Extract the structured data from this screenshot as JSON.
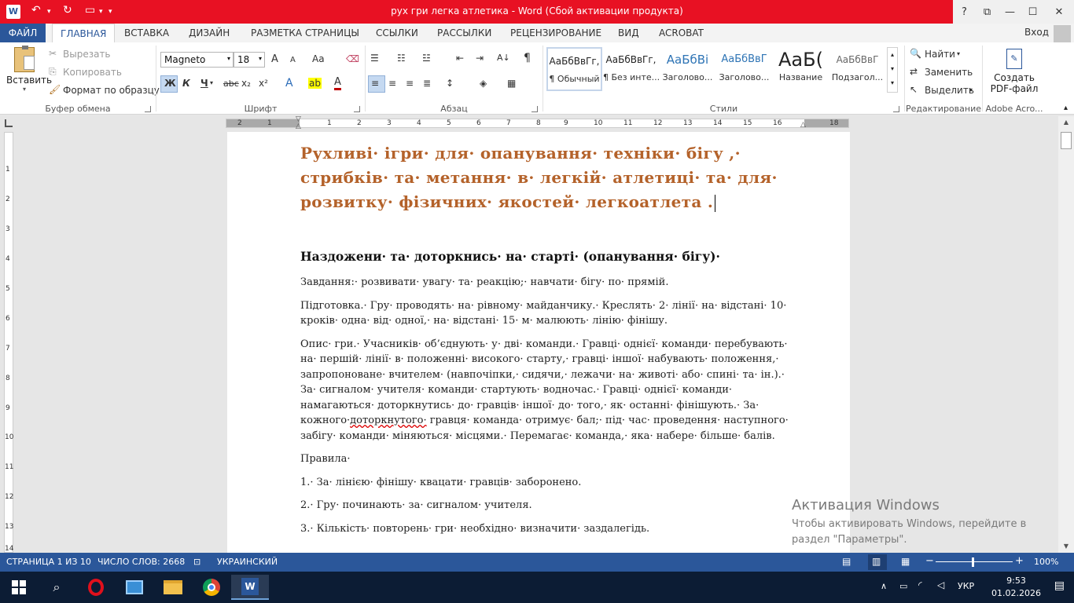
{
  "window": {
    "title": "рух гри легка атлетика -  Word (Сбой активации продукта)",
    "app_icon": "W",
    "help": "?",
    "ribbon_options": "⧉",
    "minimize": "—",
    "maximize": "☐",
    "close": "✕"
  },
  "tabs": [
    {
      "label": "ФАЙЛ"
    },
    {
      "label": "ГЛАВНАЯ"
    },
    {
      "label": "ВСТАВКА"
    },
    {
      "label": "ДИЗАЙН"
    },
    {
      "label": "РАЗМЕТКА СТРАНИЦЫ"
    },
    {
      "label": "ССЫЛКИ"
    },
    {
      "label": "РАССЫЛКИ"
    },
    {
      "label": "РЕЦЕНЗИРОВАНИЕ"
    },
    {
      "label": "ВИД"
    },
    {
      "label": "ACROBAT"
    }
  ],
  "login": "Вход",
  "clipboard": {
    "paste": "Вставить",
    "cut": "Вырезать",
    "copy": "Копировать",
    "format_painter": "Формат по образцу",
    "label": "Буфер обмена"
  },
  "font": {
    "name": "Magneto",
    "size": "18",
    "grow": "A",
    "shrink": "A",
    "case": "Aa",
    "bold": "Ж",
    "italic": "К",
    "underline": "Ч",
    "strike": "abc",
    "subscript": "x₂",
    "superscript": "x²",
    "effects": "A",
    "highlight": "ab",
    "color": "A",
    "label": "Шрифт"
  },
  "paragraph": {
    "label": "Абзац",
    "pilcrow": "¶",
    "sort": "A↓"
  },
  "styles": {
    "items": [
      {
        "preview": "АаБбВвГг,",
        "name": "¶ Обычный"
      },
      {
        "preview": "АаБбВвГг,",
        "name": "¶ Без инте..."
      },
      {
        "preview": "АаБбВі",
        "name": "Заголово..."
      },
      {
        "preview": "АаБбВвГ",
        "name": "Заголово..."
      },
      {
        "preview": "АаБ(",
        "name": "Название"
      },
      {
        "preview": "АаБбВвГ",
        "name": "Подзагол..."
      }
    ],
    "label": "Стили"
  },
  "editing": {
    "find": "Найти",
    "replace": "Заменить",
    "select": "Выделить",
    "label": "Редактирование"
  },
  "acrobat": {
    "create_pdf_line1": "Создать",
    "create_pdf_line2": "PDF-файл",
    "label": "Adobe Acro..."
  },
  "ruler": {
    "h_numbers": [
      "2",
      "1",
      "1",
      "2",
      "3",
      "4",
      "5",
      "6",
      "7",
      "8",
      "9",
      "10",
      "11",
      "12",
      "13",
      "14",
      "15",
      "16",
      "18"
    ],
    "v_numbers": [
      "1",
      "2",
      "3",
      "4",
      "5",
      "6",
      "7",
      "8",
      "9",
      "10",
      "11",
      "12",
      "13",
      "14"
    ]
  },
  "document": {
    "title": "Рухливі· ігри· для· опанування· техніки· бігу ,· стрибків· та· метання· в· легкій· атлетиці· та· для· розвитку· фізичних· якостей· легкоатлета .",
    "heading": "Наздожени· та· доторкнись· на· старті· (опанування· бігу)·",
    "p_task": "Завдання:· розвивати· увагу· та· реакцію;· навчати· бігу· по· прямій.",
    "p_prep": "Підготовка.· Гру· проводять· на· рівному· майданчику.· Креслять· 2· лінії· на· відстані· 10· кроків· одна· від· одної,· на· відстані· 15· м· малюють· лінію· фінішу.",
    "p_desc_a": "Опис· гри.· Учасників· об’єднують· у· дві· команди.· Гравці· однієї· команди· перебувають· на· першій· лінії· в· положенні· високого· старту,· гравці· іншої· набувають· положення,· запропоноване· вчителем· (навпочіпки,· сидячи,· лежачи· на· животі· або· спині· та· ін.).· За· сигналом· учителя· команди· стартують· водночас.· Гравці· однієї· команди· намагаються· доторкнутись· до· гравців· іншої· до· того,· як· останні· фінішують.· За· кожного·",
    "p_desc_wavy": "доторкнутого·",
    "p_desc_b": "гравця· команда· отримує· бал;· під· час· проведення· наступного· забігу· команди· міняються· місцями.· Перемагає· команда,· яка· набере· більше· балів.",
    "p_rules": "Правила·",
    "rule1": "1.· За· лінією· фінішу· квацати· гравців· заборонено.",
    "rule2": "2.· Гру· починають· за· сигналом· учителя.",
    "rule3": "3.· Кількість· повторень· гри· необхідно· визначити· заздалегідь."
  },
  "activation": {
    "title": "Активация Windows",
    "line": "Чтобы активировать Windows, перейдите в раздел \"Параметры\"."
  },
  "status": {
    "page": "СТРАНИЦА 1 ИЗ 10",
    "words": "ЧИСЛО СЛОВ: 2668",
    "language": "УКРАИНСКИЙ",
    "zoom": "100%"
  },
  "taskbar": {
    "lang": "УКР",
    "time": "9:53",
    "date": "01.02.2026"
  }
}
